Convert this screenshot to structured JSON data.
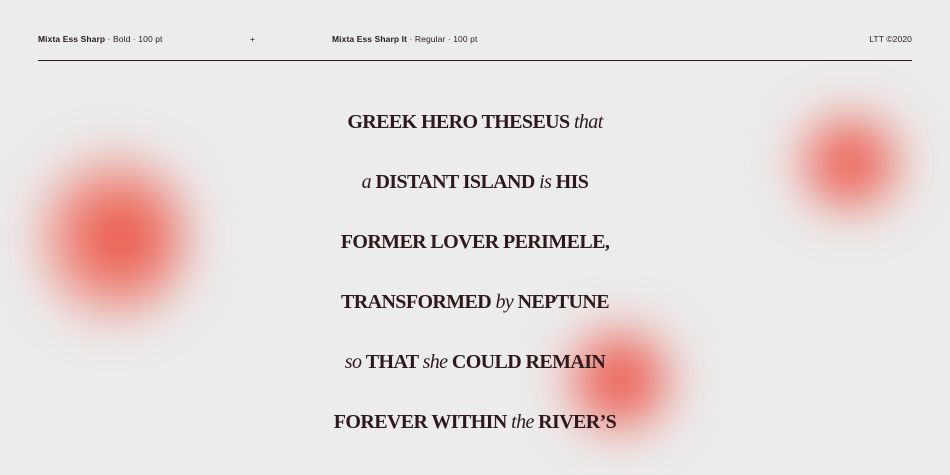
{
  "header": {
    "font_a_name": "Mixta Ess Sharp",
    "font_a_style": " · Bold · 100 pt",
    "plus": "+",
    "font_b_name": "Mixta Ess Sharp It",
    "font_b_style": " · Regular · 100 pt",
    "copyright": "LTT ©2020"
  },
  "specimen": {
    "lines": [
      [
        {
          "text": "GREEK HERO THESEUS ",
          "italic": false
        },
        {
          "text": "that",
          "italic": true
        }
      ],
      [
        {
          "text": "a ",
          "italic": true
        },
        {
          "text": "DISTANT ISLAND ",
          "italic": false
        },
        {
          "text": "is ",
          "italic": true
        },
        {
          "text": "HIS",
          "italic": false
        }
      ],
      [
        {
          "text": "FORMER LOVER PERIMELE,",
          "italic": false
        }
      ],
      [
        {
          "text": "TRANSFORMED ",
          "italic": false
        },
        {
          "text": "by ",
          "italic": true
        },
        {
          "text": "NEPTUNE",
          "italic": false
        }
      ],
      [
        {
          "text": "so ",
          "italic": true
        },
        {
          "text": "THAT ",
          "italic": false
        },
        {
          "text": "she ",
          "italic": true
        },
        {
          "text": "COULD REMAIN",
          "italic": false
        }
      ],
      [
        {
          "text": "FOREVER WITHIN ",
          "italic": false
        },
        {
          "text": "the ",
          "italic": true
        },
        {
          "text": "RIVER’S",
          "italic": false
        }
      ]
    ]
  },
  "colors": {
    "background": "#ececec",
    "ink": "#2e1a1d",
    "accent_blob": "#e83a2c"
  }
}
